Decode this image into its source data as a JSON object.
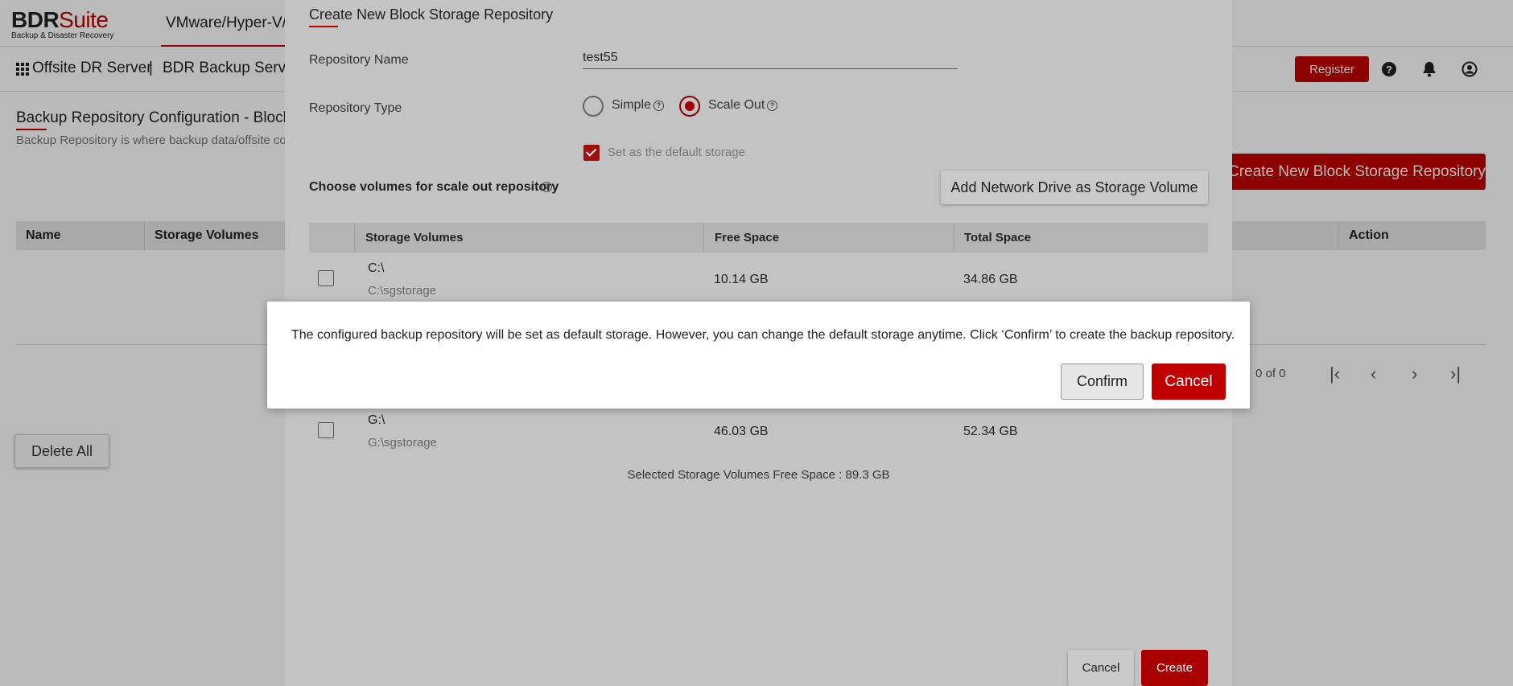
{
  "app": {
    "logo_bold": "BDR",
    "logo_light": "Suite",
    "logo_tagline": "Backup & Disaster Recovery",
    "nav_tab": "VMware/Hyper-V/V"
  },
  "subbar": {
    "crumb_root": "Offsite DR Server",
    "crumb_sep": "|",
    "crumb_current": "BDR Backup Servers",
    "register_label": "Register"
  },
  "page": {
    "title": "Backup Repository Configuration - Block Storage",
    "description": "Backup Repository is where backup data/offsite copies are stored",
    "create_button": "Create New Block Storage Repository",
    "table_columns": [
      "Name",
      "Storage Volumes",
      "Action"
    ],
    "pager_text": "0 of 0",
    "delete_all": "Delete All"
  },
  "panel": {
    "title": "Create New Block Storage Repository",
    "name_label": "Repository Name",
    "name_value": "test55",
    "type_label": "Repository Type",
    "type_simple": "Simple",
    "type_scaleout": "Scale Out",
    "selected_type": "Scale Out",
    "default_storage_label": "Set as the default storage",
    "default_storage_checked": true,
    "choose_label": "Choose volumes for scale out repository",
    "add_network_button": "Add Network Drive as Storage Volume",
    "columns": {
      "storage_volumes": "Storage Volumes",
      "free_space": "Free Space",
      "total_space": "Total Space"
    },
    "volumes": [
      {
        "drive": "C:\\",
        "path": "C:\\sgstorage",
        "free": "10.14 GB",
        "total": "34.86 GB",
        "checked": false
      },
      {
        "drive": "G:\\",
        "path": "G:\\sgstorage",
        "free": "46.03 GB",
        "total": "52.34 GB",
        "checked": false
      }
    ],
    "selected_free_space": "Selected Storage Volumes Free Space : 89.3 GB",
    "cancel_label": "Cancel",
    "create_label": "Create"
  },
  "dialog": {
    "message": "The configured backup repository will be set as default storage. However, you can change the default storage anytime. Click ‘Confirm’ to create the backup repository.",
    "confirm_label": "Confirm",
    "cancel_label": "Cancel"
  },
  "colors": {
    "brand_red": "#c00000",
    "overlay": "#000000"
  }
}
